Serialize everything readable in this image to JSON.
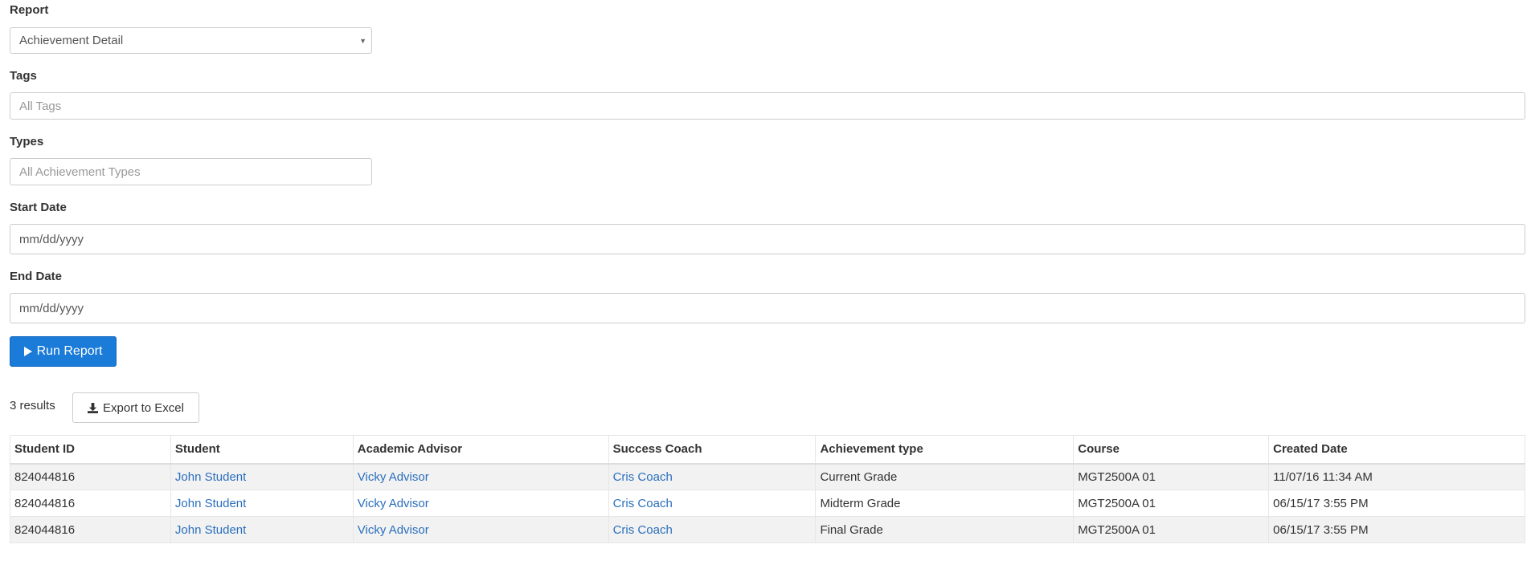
{
  "form": {
    "report_label": "Report",
    "report_value": "Achievement Detail",
    "tags_label": "Tags",
    "tags_placeholder": "All Tags",
    "types_label": "Types",
    "types_placeholder": "All Achievement Types",
    "start_label": "Start Date",
    "start_placeholder": "mm/dd/yyyy",
    "end_label": "End Date",
    "end_placeholder": "mm/dd/yyyy",
    "run_label": "Run Report"
  },
  "results": {
    "count_text": "3 results",
    "export_label": "Export to Excel"
  },
  "table": {
    "headers": [
      "Student ID",
      "Student",
      "Academic Advisor",
      "Success Coach",
      "Achievement type",
      "Course",
      "Created Date"
    ],
    "rows": [
      [
        "824044816",
        "John Student",
        "Vicky Advisor",
        "Cris Coach",
        "Current Grade",
        "MGT2500A 01",
        "11/07/16 11:34 AM"
      ],
      [
        "824044816",
        "John Student",
        "Vicky Advisor",
        "Cris Coach",
        "Midterm Grade",
        "MGT2500A 01",
        "06/15/17 3:55 PM"
      ],
      [
        "824044816",
        "John Student",
        "Vicky Advisor",
        "Cris Coach",
        "Final Grade",
        "MGT2500A 01",
        "06/15/17 3:55 PM"
      ]
    ]
  },
  "colors": {
    "primary": "#1a7bd9",
    "link": "#2a6fbd",
    "stripe": "#f2f2f2"
  },
  "icons": {
    "run": "play-icon",
    "export": "download-icon",
    "select": "chevron-down-icon"
  }
}
